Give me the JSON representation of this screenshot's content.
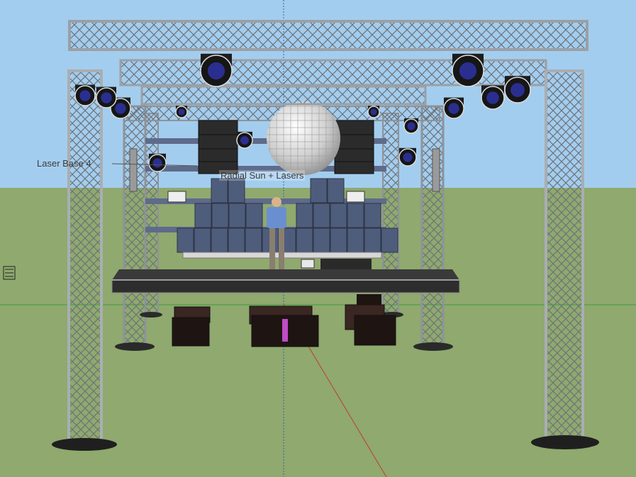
{
  "app": {
    "kind": "3D modeling viewport",
    "sky_color": "#a3cdee",
    "ground_color": "#8fa96e"
  },
  "labels": {
    "laser_left": "Laser Base 4",
    "laser_center": "Radial Sun + Lasers"
  },
  "icons": [
    "axes-origin-icon",
    "disco-ball-icon",
    "dj-figure-icon",
    "moving-head-light-icon",
    "speaker-icon",
    "subwoofer-icon",
    "truss-icon"
  ]
}
